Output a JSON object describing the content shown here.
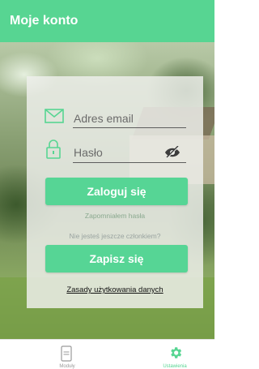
{
  "appbar": {
    "title": "Moje konto"
  },
  "login": {
    "email_placeholder": "Adres email",
    "password_placeholder": "Hasło",
    "login_button": "Zaloguj się",
    "forgot_password": "Zapomniałem hasła",
    "not_member": "Nie jesteś jeszcze członkiem?",
    "register_button": "Zapisz się",
    "terms_link": "Zasady użytkowania danych"
  },
  "bottom_nav": {
    "items": [
      {
        "label": "Moduły",
        "icon": "module-icon",
        "active": false
      },
      {
        "label": "Ustawienia",
        "icon": "gear-icon",
        "active": true
      }
    ]
  },
  "colors": {
    "accent": "#57d592"
  }
}
